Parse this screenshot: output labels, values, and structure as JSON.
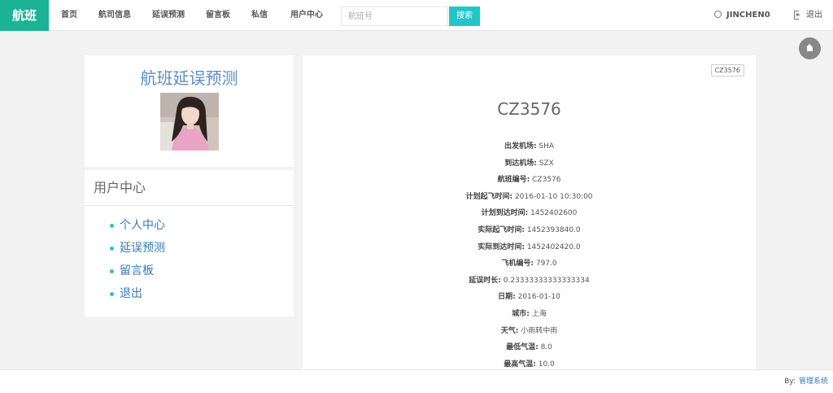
{
  "navbar": {
    "brand": "航班",
    "items": [
      {
        "label": "首页"
      },
      {
        "label": "航司信息"
      },
      {
        "label": "延误预测"
      },
      {
        "label": "留言板"
      },
      {
        "label": "私信"
      },
      {
        "label": "用户中心"
      }
    ],
    "search": {
      "placeholder": "航班号",
      "button_label": "搜索"
    },
    "username": "JINCHEN0",
    "logout_label": "退出"
  },
  "sidebar": {
    "site_title": "航班延误预测",
    "menu_title": "用户中心",
    "menu_items": [
      {
        "label": "个人中心"
      },
      {
        "label": "延误预测"
      },
      {
        "label": "留言板"
      },
      {
        "label": "退出"
      }
    ]
  },
  "flight": {
    "badge": "CZ3576",
    "title": "CZ3576",
    "fields": [
      {
        "label": "出发机场:",
        "value": "SHA"
      },
      {
        "label": "到达机场:",
        "value": "SZX"
      },
      {
        "label": "航班编号:",
        "value": "CZ3576"
      },
      {
        "label": "计划起飞时间:",
        "value": "2016-01-10 10:30:00"
      },
      {
        "label": "计划到达时间:",
        "value": "1452402600"
      },
      {
        "label": "实际起飞时间:",
        "value": "1452393840.0"
      },
      {
        "label": "实际到达时间:",
        "value": "1452402420.0"
      },
      {
        "label": "飞机编号:",
        "value": "797.0"
      },
      {
        "label": "延误时长:",
        "value": "0.23333333333333334"
      },
      {
        "label": "日期:",
        "value": "2016-01-10"
      },
      {
        "label": "城市:",
        "value": "上海"
      },
      {
        "label": "天气:",
        "value": "小雨转中雨"
      },
      {
        "label": "最低气温:",
        "value": "8.0"
      },
      {
        "label": "最高气温:",
        "value": "10.0"
      }
    ]
  },
  "footer": {
    "prefix": "By:",
    "link": "管理系统"
  },
  "colors": {
    "brand": "#1ab394",
    "accent": "#23c6c8",
    "link": "#337ab7",
    "title": "#5b8ec2"
  }
}
